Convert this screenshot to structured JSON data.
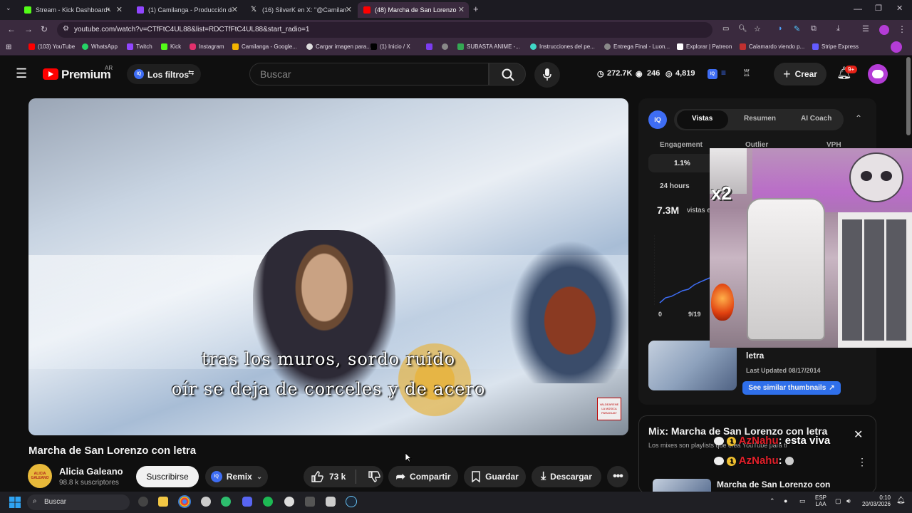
{
  "browser": {
    "tabs": [
      {
        "title": "Stream - Kick Dashboard",
        "color": "#53fc18"
      },
      {
        "title": "(1) Camilanga - Producción de",
        "color": "#9146ff"
      },
      {
        "title": "(16) SilverK en X: \"@Camilama",
        "color": "#ffffff"
      },
      {
        "title": "(48) Marcha de San Lorenzo co",
        "color": "#ff0000"
      }
    ],
    "url": "youtube.com/watch?v=CTfFtC4UL88&list=RDCTfFtC4UL88&start_radio=1",
    "bookmarks": [
      "(103) YouTube",
      "WhatsApp",
      "Twitch",
      "Kick",
      "Instagram",
      "Camilanga - Google...",
      "Cargar imagen para...",
      "(1) Inicio / X",
      "SUBASTA ANIME -...",
      "Instrucciones del pe...",
      "Entrega Final - Luon...",
      "Explorar | Patreon",
      "Calamardo viendo p...",
      "Stripe Express"
    ]
  },
  "header": {
    "logo": "Premium",
    "region": "AR",
    "filters": "Los filtros",
    "search_placeholder": "Buscar",
    "stat_subs": "272.7K",
    "stat_views": "246",
    "stat_watch": "4,819",
    "create": "Crear",
    "notif_count": "9+"
  },
  "video": {
    "subtitle_line1": "tras los muros, sordo ruido",
    "subtitle_line2": "oír se deja de corceles y de acero",
    "watermark": "VALDEARENE LA MÚSICA PARAGUAY",
    "title": "Marcha de San Lorenzo con letra"
  },
  "channel": {
    "avatar_text": "ALICIA GALEANO",
    "name": "Alicia Galeano",
    "subs": "98.8 k suscriptores",
    "subscribe": "Suscribirse"
  },
  "actions": {
    "remix": "Remix",
    "likes": "73 k",
    "share": "Compartir",
    "save": "Guardar",
    "download": "Descargar"
  },
  "iq_panel": {
    "logo": "IQ",
    "tabs": [
      "Vistas",
      "Resumen",
      "AI Coach"
    ],
    "engagement_label": "Engagement",
    "outlier_label": "Outlier",
    "vph_label": "VPH",
    "engagement_value": "1.1%",
    "period": "24 hours",
    "views_big": "7.3M",
    "views_suffix": "vistas e",
    "chart_y0": "0",
    "chart_x": "9/19",
    "thumb_title": "letra",
    "last_updated": "Last Updated 08/17/2014",
    "similar": "See similar thumbnails"
  },
  "overlay": {
    "multiplier": "x2",
    "chat1_user": "AzNahu",
    "chat1_msg": ": esta viva",
    "chat2_user": "AzNahu",
    "chat2_msg": ":"
  },
  "mix": {
    "title": "Mix: Marcha de San Lorenzo con letra",
    "desc": "Los mixes son playlists que crea YouTube para ti",
    "item_title": "Marcha de San Lorenzo con"
  },
  "taskbar": {
    "search": "Buscar",
    "lang": "ESP",
    "lang2": "LAA",
    "time": "0:10",
    "date": "20/03/2026"
  }
}
